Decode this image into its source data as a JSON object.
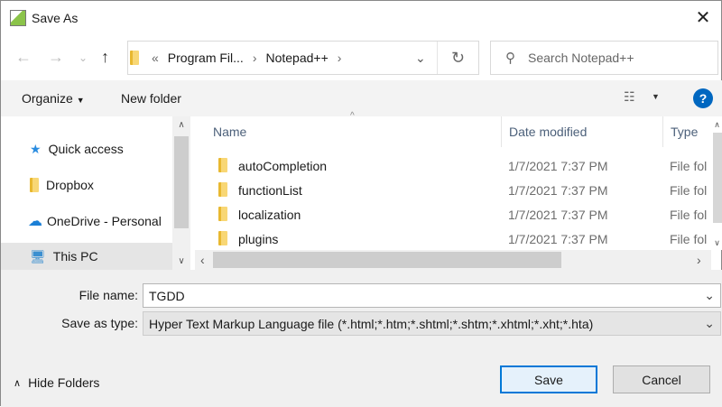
{
  "window": {
    "title": "Save As"
  },
  "address": {
    "overflow": "«",
    "crumbs": [
      "Program Fil...",
      "Notepad++"
    ]
  },
  "search": {
    "placeholder": "Search Notepad++"
  },
  "toolbar": {
    "organize": "Organize",
    "new_folder": "New folder",
    "help": "?"
  },
  "nav": {
    "items": [
      {
        "label": "Quick access"
      },
      {
        "label": "Dropbox"
      },
      {
        "label": "OneDrive - Personal"
      },
      {
        "label": "This PC"
      }
    ]
  },
  "list": {
    "columns": [
      "Name",
      "Date modified",
      "Type"
    ],
    "rows": [
      {
        "name": "autoCompletion",
        "date": "1/7/2021 7:37 PM",
        "type": "File fol"
      },
      {
        "name": "functionList",
        "date": "1/7/2021 7:37 PM",
        "type": "File fol"
      },
      {
        "name": "localization",
        "date": "1/7/2021 7:37 PM",
        "type": "File fol"
      },
      {
        "name": "plugins",
        "date": "1/7/2021 7:37 PM",
        "type": "File fol"
      }
    ]
  },
  "form": {
    "file_name_label": "File name:",
    "file_name": "TGDD",
    "type_label": "Save as type:",
    "type_value": "Hyper Text Markup Language file (*.html;*.htm;*.shtml;*.shtm;*.xhtml;*.xht;*.hta)"
  },
  "footer": {
    "hide_folders": "Hide Folders",
    "save": "Save",
    "cancel": "Cancel"
  },
  "colors": {
    "accent": "#0067c0",
    "selected": "#cce8ff"
  }
}
